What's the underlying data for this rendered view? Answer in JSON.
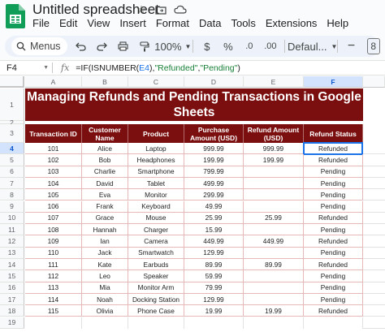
{
  "app": {
    "doc_title": "Untitled spreadsheet",
    "menu": [
      "File",
      "Edit",
      "View",
      "Insert",
      "Format",
      "Data",
      "Tools",
      "Extensions",
      "Help"
    ]
  },
  "toolbar": {
    "menus_label": "Menus",
    "zoom": "100%",
    "currency": "$",
    "percent": "%",
    "decrease_decimal": ".0",
    "increase_decimal": ".00",
    "font": "Defaul...",
    "font_size": "8"
  },
  "formula_bar": {
    "cell_ref": "F4",
    "fx": "fx",
    "formula_prefix": "=IF(ISNUMBER(",
    "formula_ref": "E4",
    "formula_mid": "),",
    "formula_str1": "\"Refunded\"",
    "formula_comma": ",",
    "formula_str2": "\"Pending\"",
    "formula_suffix": ")"
  },
  "sheet": {
    "columns": [
      "A",
      "B",
      "C",
      "D",
      "E",
      "F"
    ],
    "selected_column": "F",
    "selected_row": "4",
    "title": "Managing Refunds and Pending Transactions in Google Sheets",
    "headers": [
      "Transaction ID",
      "Customer Name",
      "Product",
      "Purchase Amount (USD)",
      "Refund Amount (USD)",
      "Refund Status"
    ],
    "rows": [
      {
        "row": "4",
        "cells": [
          "101",
          "Alice",
          "Laptop",
          "999.99",
          "999.99",
          "Refunded"
        ]
      },
      {
        "row": "5",
        "cells": [
          "102",
          "Bob",
          "Headphones",
          "199.99",
          "199.99",
          "Refunded"
        ]
      },
      {
        "row": "6",
        "cells": [
          "103",
          "Charlie",
          "Smartphone",
          "799.99",
          "",
          "Pending"
        ]
      },
      {
        "row": "7",
        "cells": [
          "104",
          "David",
          "Tablet",
          "499.99",
          "",
          "Pending"
        ]
      },
      {
        "row": "8",
        "cells": [
          "105",
          "Eva",
          "Monitor",
          "299.99",
          "",
          "Pending"
        ]
      },
      {
        "row": "9",
        "cells": [
          "106",
          "Frank",
          "Keyboard",
          "49.99",
          "",
          "Pending"
        ]
      },
      {
        "row": "10",
        "cells": [
          "107",
          "Grace",
          "Mouse",
          "25.99",
          "25.99",
          "Refunded"
        ]
      },
      {
        "row": "11",
        "cells": [
          "108",
          "Hannah",
          "Charger",
          "15.99",
          "",
          "Pending"
        ]
      },
      {
        "row": "12",
        "cells": [
          "109",
          "Ian",
          "Camera",
          "449.99",
          "449.99",
          "Refunded"
        ]
      },
      {
        "row": "13",
        "cells": [
          "110",
          "Jack",
          "Smartwatch",
          "129.99",
          "",
          "Pending"
        ]
      },
      {
        "row": "14",
        "cells": [
          "111",
          "Kate",
          "Earbuds",
          "89.99",
          "89.99",
          "Refunded"
        ]
      },
      {
        "row": "15",
        "cells": [
          "112",
          "Leo",
          "Speaker",
          "59.99",
          "",
          "Pending"
        ]
      },
      {
        "row": "16",
        "cells": [
          "113",
          "Mia",
          "Monitor Arm",
          "79.99",
          "",
          "Pending"
        ]
      },
      {
        "row": "17",
        "cells": [
          "114",
          "Noah",
          "Docking Station",
          "129.99",
          "",
          "Pending"
        ]
      },
      {
        "row": "18",
        "cells": [
          "115",
          "Olivia",
          "Phone Case",
          "19.99",
          "19.99",
          "Refunded"
        ]
      },
      {
        "row": "19",
        "cells": [
          "",
          "",
          "",
          "",
          "",
          ""
        ]
      }
    ],
    "row_labels_top": [
      "1",
      "2",
      "3"
    ]
  },
  "colors": {
    "banner": "#7b0e0e",
    "accent": "#1a73e8",
    "sheets_green": "#0f9d58"
  }
}
